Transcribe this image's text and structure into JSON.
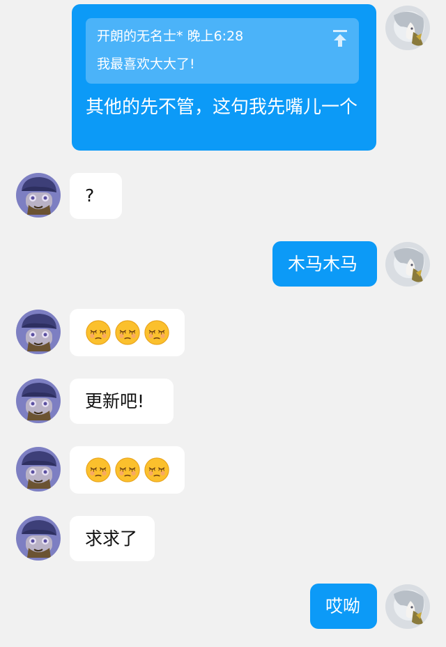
{
  "messages": [
    {
      "id": "m1",
      "side": "right",
      "reply_quote": {
        "author": "开朗的无名士*",
        "time": "晚上6:28",
        "text": "我最喜欢大大了!"
      },
      "text": "其他的先不管，这句我先嘴儿一个"
    },
    {
      "id": "m2",
      "side": "left",
      "text": "?"
    },
    {
      "id": "m3",
      "side": "right",
      "text": "木马木马"
    },
    {
      "id": "m4",
      "side": "left",
      "emoji": [
        "sleepy-face-emoji",
        "sleepy-face-emoji",
        "sleepy-face-emoji"
      ]
    },
    {
      "id": "m5",
      "side": "left",
      "text": "更新吧!"
    },
    {
      "id": "m6",
      "side": "left",
      "emoji": [
        "sleepy-face-emoji",
        "sleepy-face-emoji",
        "sleepy-face-emoji"
      ]
    },
    {
      "id": "m7",
      "side": "left",
      "text": "求求了"
    },
    {
      "id": "m8",
      "side": "right",
      "text": "哎呦"
    }
  ],
  "colors": {
    "background": "#f1f1f1",
    "outgoing_bubble": "#0c9af7",
    "incoming_bubble": "#ffffff",
    "quote_card": "#4bb3f9"
  },
  "icons": {
    "quote_jump": "arrow-up-to-top-icon"
  }
}
